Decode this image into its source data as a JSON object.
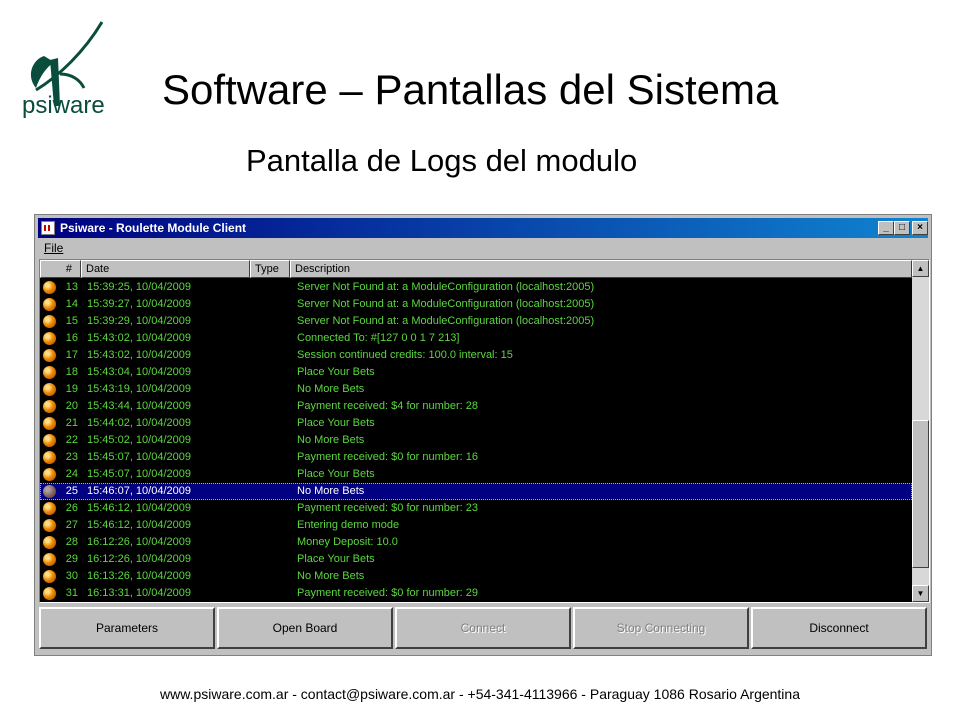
{
  "brand": {
    "name": "psiware",
    "color": "#0a4d3c"
  },
  "slide": {
    "title": "Software – Pantallas del Sistema",
    "subtitle": "Pantalla de Logs del modulo",
    "footer": "www.psiware.com.ar  - contact@psiware.com.ar  - +54-341-4113966  - Paraguay  1086 Rosario Argentina"
  },
  "window": {
    "title": "Psiware - Roulette Module Client",
    "menu": [
      "File"
    ],
    "columns": [
      "#",
      "Date",
      "Type",
      "Description"
    ],
    "rows": [
      {
        "num": "13",
        "date": "15:39:25, 10/04/2009",
        "type": "",
        "desc": " Server Not Found at: a ModuleConfiguration (localhost:2005)"
      },
      {
        "num": "14",
        "date": "15:39:27, 10/04/2009",
        "type": "",
        "desc": " Server Not Found at: a ModuleConfiguration (localhost:2005)"
      },
      {
        "num": "15",
        "date": "15:39:29, 10/04/2009",
        "type": "",
        "desc": " Server Not Found at: a ModuleConfiguration (localhost:2005)"
      },
      {
        "num": "16",
        "date": "15:43:02, 10/04/2009",
        "type": "",
        "desc": "Connected To: #[127 0 0 1 7 213]"
      },
      {
        "num": "17",
        "date": "15:43:02, 10/04/2009",
        "type": "",
        "desc": "Session continued credits: 100.0 interval: 15"
      },
      {
        "num": "18",
        "date": "15:43:04, 10/04/2009",
        "type": "",
        "desc": "Place Your Bets"
      },
      {
        "num": "19",
        "date": "15:43:19, 10/04/2009",
        "type": "",
        "desc": "No More Bets"
      },
      {
        "num": "20",
        "date": "15:43:44, 10/04/2009",
        "type": "",
        "desc": " Payment received: $4 for number: 28"
      },
      {
        "num": "21",
        "date": "15:44:02, 10/04/2009",
        "type": "",
        "desc": "Place Your Bets"
      },
      {
        "num": "22",
        "date": "15:45:02, 10/04/2009",
        "type": "",
        "desc": "No More Bets"
      },
      {
        "num": "23",
        "date": "15:45:07, 10/04/2009",
        "type": "",
        "desc": " Payment received: $0 for number: 16"
      },
      {
        "num": "24",
        "date": "15:45:07, 10/04/2009",
        "type": "",
        "desc": "Place Your Bets"
      },
      {
        "num": "25",
        "date": "15:46:07, 10/04/2009",
        "type": "",
        "desc": "No More Bets",
        "selected": true
      },
      {
        "num": "26",
        "date": "15:46:12, 10/04/2009",
        "type": "",
        "desc": " Payment received: $0 for number: 23"
      },
      {
        "num": "27",
        "date": "15:46:12, 10/04/2009",
        "type": "",
        "desc": "Entering demo mode"
      },
      {
        "num": "28",
        "date": "16:12:26, 10/04/2009",
        "type": "",
        "desc": "Money Deposit: 10.0"
      },
      {
        "num": "29",
        "date": "16:12:26, 10/04/2009",
        "type": "",
        "desc": "Place Your Bets"
      },
      {
        "num": "30",
        "date": "16:13:26, 10/04/2009",
        "type": "",
        "desc": "No More Bets"
      },
      {
        "num": "31",
        "date": "16:13:31, 10/04/2009",
        "type": "",
        "desc": " Payment received: $0 for number: 29"
      }
    ],
    "buttons": [
      {
        "label": "Parameters",
        "enabled": true
      },
      {
        "label": "Open Board",
        "enabled": true
      },
      {
        "label": "Connect",
        "enabled": false
      },
      {
        "label": "Stop Connecting",
        "enabled": false
      },
      {
        "label": "Disconnect",
        "enabled": true
      }
    ],
    "colors": {
      "log_text": "#5cd640",
      "log_background": "#000000",
      "selection": "#000080",
      "title_bar": "#000080"
    },
    "icons": {
      "row_status": "orange-ball-icon",
      "window_controls": [
        "minimize-icon",
        "maximize-icon",
        "close-icon"
      ],
      "scroll": [
        "scroll-up-icon",
        "scroll-down-icon"
      ]
    }
  }
}
